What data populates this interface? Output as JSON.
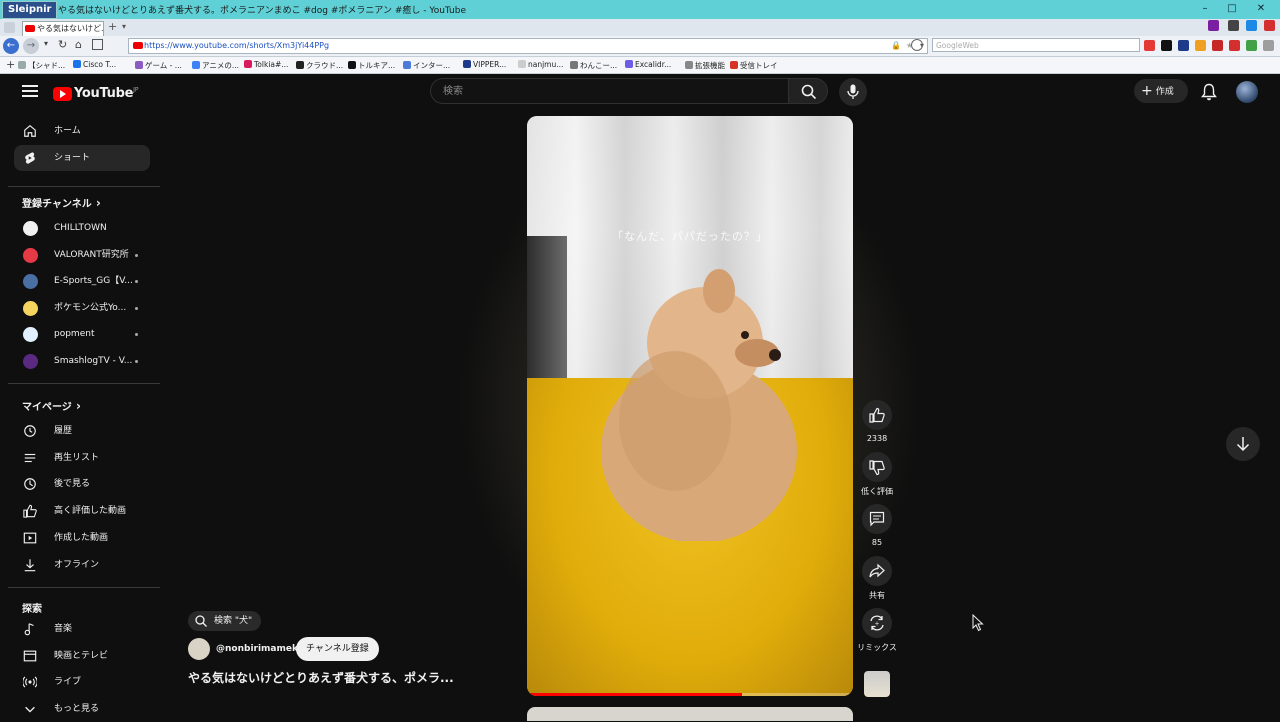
{
  "window": {
    "app_name": "Sleipnir",
    "title": "やる気はないけどとりあえず番犬する。ポメラニアンまめこ #dog #ポメラニアン #癒し - YouTube"
  },
  "tab": {
    "label": "やる気はないけど..."
  },
  "address": {
    "url": "https://www.youtube.com/shorts/Xm3jYi44PPg",
    "web_search_placeholder": "GoogleWeb"
  },
  "bookmarks": [
    {
      "label": "【シャド...",
      "color": "#9aa"
    },
    {
      "label": "Cisco T...",
      "color": "#1a73e8"
    },
    {
      "label": "ゲーム - ...",
      "color": "#8a5cc2"
    },
    {
      "label": "アニメの...",
      "color": "#3b82f6"
    },
    {
      "label": "Tolkia#...",
      "color": "#d81b60"
    },
    {
      "label": "クラウド...",
      "color": "#222"
    },
    {
      "label": "トルキア...",
      "color": "#111"
    },
    {
      "label": "インター...",
      "color": "#4c7bd9"
    },
    {
      "label": "VIPPER...",
      "color": "#1e3a8a"
    },
    {
      "label": "nanjmu...",
      "color": "#ccc"
    },
    {
      "label": "わんこー...",
      "color": "#777"
    },
    {
      "label": "Excalidr...",
      "color": "#6c5ce7"
    },
    {
      "label": "拡張機能",
      "color": "#888"
    },
    {
      "label": "受信トレイ",
      "color": "#d93025"
    }
  ],
  "youtube": {
    "logo_text": "YouTube",
    "region": "JP",
    "search_placeholder": "検索",
    "create_label": "作成"
  },
  "sidebar": {
    "main": [
      {
        "label": "ホーム",
        "icon": "home-icon"
      },
      {
        "label": "ショート",
        "icon": "shorts-icon",
        "active": true
      }
    ],
    "subscriptions_heading": "登録チャンネル",
    "subscriptions": [
      {
        "label": "CHILLTOWN",
        "color": "#f1f1f1",
        "dot": false
      },
      {
        "label": "VALORANT研究所",
        "color": "#e63946",
        "dot": true
      },
      {
        "label": "E-Sports_GG【V...",
        "color": "#4a6fa5",
        "dot": true
      },
      {
        "label": "ポケモン公式Yo...",
        "color": "#f4d35e",
        "dot": true
      },
      {
        "label": "popment",
        "color": "#e0f0ff",
        "dot": true
      },
      {
        "label": "SmashlogTV - V...",
        "color": "#5a2a82",
        "dot": true
      }
    ],
    "you_heading": "マイページ",
    "you": [
      {
        "label": "履歴",
        "icon": "history-icon"
      },
      {
        "label": "再生リスト",
        "icon": "playlist-icon"
      },
      {
        "label": "後で見る",
        "icon": "watch-later-icon"
      },
      {
        "label": "高く評価した動画",
        "icon": "liked-icon"
      },
      {
        "label": "作成した動画",
        "icon": "your-videos-icon"
      },
      {
        "label": "オフライン",
        "icon": "download-icon"
      }
    ],
    "explore_heading": "探索",
    "explore": [
      {
        "label": "音楽",
        "icon": "music-icon"
      },
      {
        "label": "映画とテレビ",
        "icon": "movies-icon"
      },
      {
        "label": "ライブ",
        "icon": "live-icon"
      },
      {
        "label": "もっと見る",
        "icon": "chevron-down-icon"
      }
    ]
  },
  "short": {
    "overlay_caption": "「なんだ、パパだったの？」",
    "progress_fraction": 0.66,
    "search_chip": "検索 \"犬\"",
    "channel_name": "@nonbirimameko",
    "subscribe_label": "チャンネル登録",
    "title": "やる気はないけどとりあえず番犬する、ポメラ..."
  },
  "actions": {
    "likes": "2338",
    "dislike_label": "低く評価",
    "comments": "85",
    "share_label": "共有",
    "remix_label": "リミックス"
  },
  "colors": {
    "accent": "#ff0000",
    "background": "#0f0f0f",
    "titlebar": "#5fd0d6"
  }
}
